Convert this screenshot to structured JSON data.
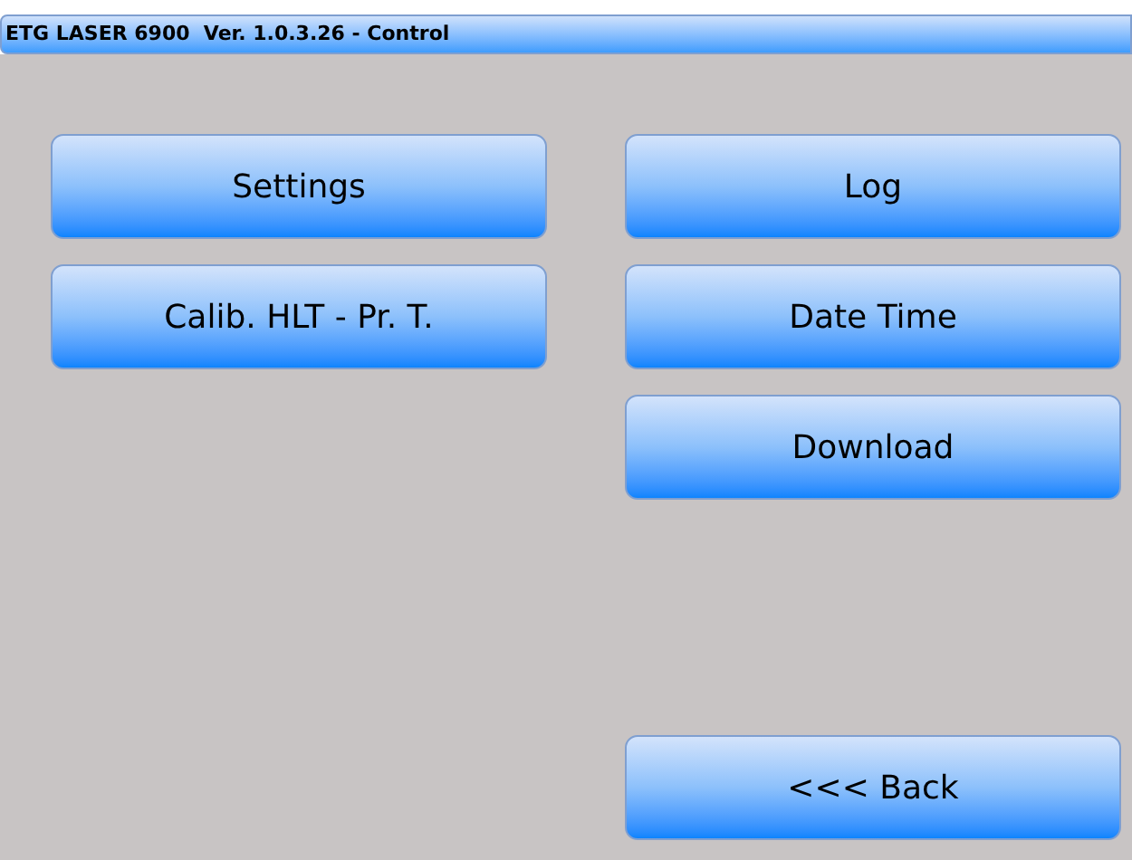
{
  "window": {
    "title": "ETG LASER 6900  Ver. 1.0.3.26 - Control"
  },
  "left_buttons": [
    "Settings",
    "Calib. HLT - Pr. T."
  ],
  "right_buttons": [
    "Log",
    "Date Time",
    "Download"
  ],
  "back_button": "<<< Back"
}
